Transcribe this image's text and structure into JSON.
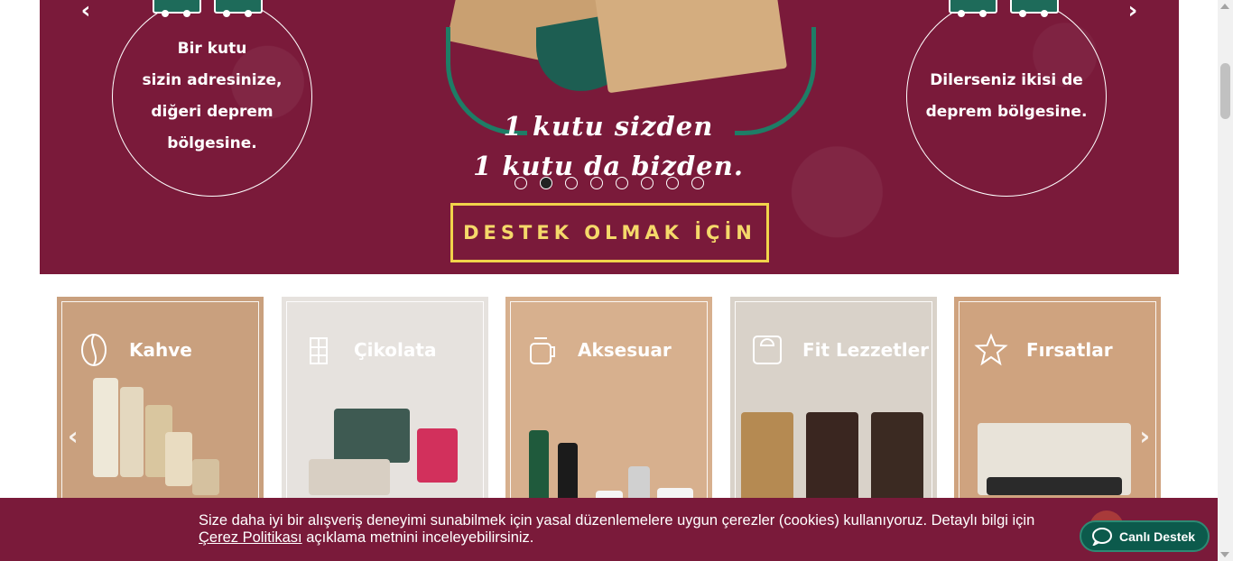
{
  "hero": {
    "prev_label": "‹",
    "next_label": "›",
    "left_circle_text": "Bir kutu\nsizin adresinize,\ndiğeri deprem\nbölgesine.",
    "right_circle_text": "Dilerseniz ikisi de\ndeprem bölgesine.",
    "slogan_line1": "1 kutu sizden",
    "slogan_line2": "1 kutu da bizden.",
    "cta_label": "DESTEK OLMAK İÇİN",
    "slide_count": 8,
    "active_slide": 2
  },
  "categories": [
    {
      "label": "Kahve",
      "icon": "coffee-bean-icon"
    },
    {
      "label": "Çikolata",
      "icon": "chocolate-bar-icon"
    },
    {
      "label": "Aksesuar",
      "icon": "jar-mug-icon"
    },
    {
      "label": "Fit Lezzetler",
      "icon": "scale-icon"
    },
    {
      "label": "Fırsatlar",
      "icon": "star-icon"
    }
  ],
  "card_nav": {
    "prev": "‹",
    "next": "›"
  },
  "cookie": {
    "text_before": "Size daha iyi bir alışveriş deneyimi sunabilmek için yasal düzenlemelere uygun çerezler (cookies) kullanıyoruz. Detaylı bilgi için ",
    "link_text": "Çerez Politikası",
    "text_after": " açıklama metnini inceleyebilirsiniz."
  },
  "support": {
    "label": "Canlı Destek",
    "icon": "chat-bubble-icon"
  },
  "colors": {
    "brand": "#7a1a3a",
    "cta_gold": "#f1d34a",
    "support_green": "#0c5a4c"
  }
}
